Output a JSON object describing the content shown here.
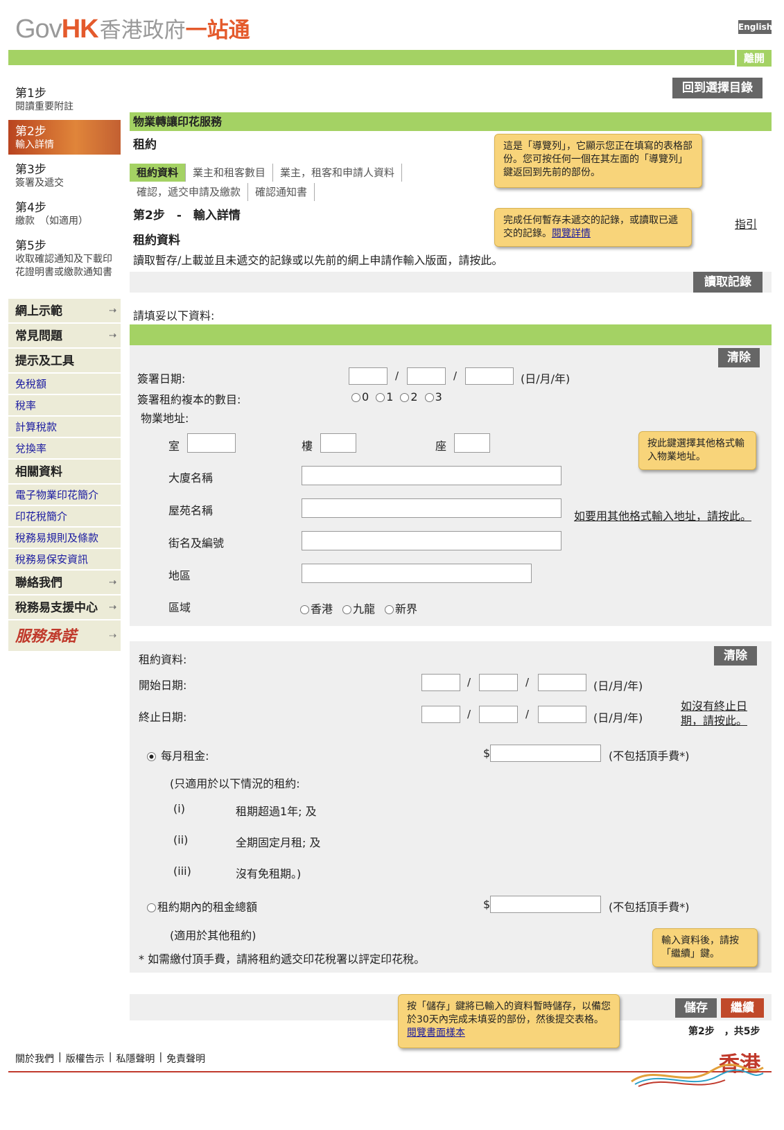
{
  "header": {
    "logo_gov": "Gov",
    "logo_hk": "HK",
    "logo_cn1": "香港政府",
    "logo_cn2": "一站通",
    "lang": "English",
    "leave": "離開"
  },
  "steps": [
    {
      "n": "第1步",
      "d": "閱讀重要附註"
    },
    {
      "n": "第2步",
      "d": "輸入詳情"
    },
    {
      "n": "第3步",
      "d": "簽署及遞交"
    },
    {
      "n": "第4步",
      "d": "繳款　（如適用）"
    },
    {
      "n": "第5步",
      "d": "收取確認通知及下載印花證明書或繳款通知書"
    }
  ],
  "menu": {
    "demo": "網上示範",
    "faq": "常見問題",
    "tips": "提示及工具",
    "exempt": "免稅額",
    "rates": "稅率",
    "calc": "計算稅款",
    "fx": "兌換率",
    "related": "相關資料",
    "estamp": "電子物業印花簡介",
    "stampintro": "印花稅簡介",
    "terms": "稅務易規則及條款",
    "security": "稅務易保安資訊",
    "contact": "聯絡我們",
    "support": "稅務易支援中心",
    "pledge": "服務承諾"
  },
  "back": "回到選擇目錄",
  "section": "物業轉讓印花服務",
  "subtitle": "租約",
  "breadcrumb": [
    "租約資料",
    "業主和租客數目",
    "業主，租客和申請人資料",
    "確認，遞交申請及繳款",
    "確認通知書"
  ],
  "step_title": "第2步　-　輸入詳情",
  "form_title": "租約資料",
  "guide": "指引",
  "retrieve_text": "讀取暫存/上載並且未遞交的記錄或以先前的網上申請作輸入版面，請按此。",
  "retrieve_btn": "讀取記錄",
  "fill_prompt": "請填妥以下資料:",
  "clear": "清除",
  "sign_date": "簽署日期:",
  "copies": "簽署租約複本的數目:",
  "copy_opts": [
    "0",
    "1",
    "2",
    "3"
  ],
  "address": "物業地址:",
  "room": "室",
  "floor": "樓",
  "block": "座",
  "bldg": "大廈名稱",
  "estate": "屋苑名稱",
  "street": "街名及編號",
  "district": "地區",
  "region": "區域",
  "region_opts": [
    "香港",
    "九龍",
    "新界"
  ],
  "other_addr": "如要用其他格式輸入地址，請按此。",
  "dmy": "(日/月/年)",
  "slash": "/",
  "lease_info": "租約資料:",
  "start_date": "開始日期:",
  "end_date": "終止日期:",
  "no_end": "如沒有終止日期，請按此。",
  "monthly": "每月租金:",
  "dollar": "$",
  "excl": "(不包括頂手費*)",
  "applies": "(只適用於以下情況的租約:",
  "cond": [
    [
      "(i)",
      "租期超過1年; 及"
    ],
    [
      "(ii)",
      "全期固定月租; 及"
    ],
    [
      "(iii)",
      "沒有免租期。)"
    ]
  ],
  "total": "租約期內的租金總額",
  "other_lease": "(適用於其他租約)",
  "note": "* 如需繳付頂手費，請將租約遞交印花稅署以評定印花稅。",
  "save": "儲存",
  "cont": "繼續",
  "progress": "第2步　，共5步",
  "tips": {
    "t1": "這是「導覽列」，它顯示您正在填寫的表格部份。您可按任何一個在其左面的「導覽列」鍵返回到先前的部份。",
    "t2a": "完成任何暫存未遞交的記錄，或讀取已遞交的記錄。",
    "t2b": "閱覽詳情",
    "t3": "按此鍵選擇其他格式輸入物業地址。",
    "t4": "輸入資料後，請按「繼續」鍵。",
    "t5a": "按「儲存」鍵將已輸入的資料暫時儲存，以備您於30天內完成未填妥的部份，然後提交表格。",
    "t5b": "閱覽書面樣本"
  },
  "footer": {
    "about": "關於我們",
    "copyright": "版權告示",
    "privacy": "私隱聲明",
    "disclaimer": "免責聲明",
    "brand": "香港"
  }
}
